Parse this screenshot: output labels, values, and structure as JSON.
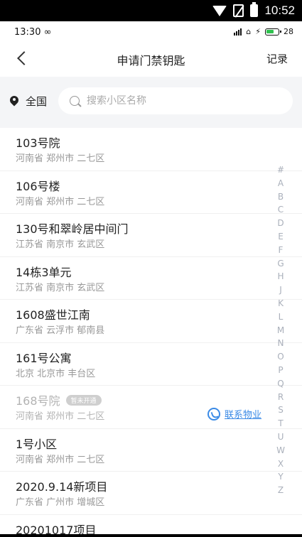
{
  "system_status": {
    "time": "10:52",
    "icons": [
      "wifi-icon",
      "no-sim-icon",
      "battery-icon"
    ]
  },
  "app_status": {
    "time": "13:30",
    "battery": "28"
  },
  "nav": {
    "title": "申请门禁钥匙",
    "record_label": "记录"
  },
  "search": {
    "region": "全国",
    "placeholder": "搜索小区名称",
    "value": ""
  },
  "items": [
    {
      "name": "103号院",
      "address": "河南省 郑州市 二七区"
    },
    {
      "name": "106号楼",
      "address": "河南省 郑州市 二七区"
    },
    {
      "name": "130号和翠岭居中间门",
      "address": "江苏省 南京市 玄武区"
    },
    {
      "name": "14栋3单元",
      "address": "江苏省 南京市 玄武区"
    },
    {
      "name": "1608盛世江南",
      "address": "广东省 云浮市 郁南县"
    },
    {
      "name": "161号公寓",
      "address": "北京 北京市 丰台区"
    },
    {
      "name": "168号院",
      "address": "河南省 郑州市 二七区",
      "badge": "暂未开通",
      "action": "联系物业",
      "disabled": true
    },
    {
      "name": "1号小区",
      "address": "河南省 郑州市 二七区"
    },
    {
      "name": "2020.9.14新项目",
      "address": "广东省 广州市 增城区"
    },
    {
      "name": "20201017项目",
      "address": ""
    }
  ],
  "alphabet": [
    "#",
    "A",
    "B",
    "C",
    "D",
    "E",
    "F",
    "G",
    "H",
    "J",
    "K",
    "L",
    "M",
    "N",
    "O",
    "P",
    "Q",
    "R",
    "S",
    "T",
    "U",
    "W",
    "X",
    "Y",
    "Z"
  ],
  "colors": {
    "accent": "#3a8ae6",
    "index": "#aab0bb",
    "background": "#f4f5f7"
  }
}
